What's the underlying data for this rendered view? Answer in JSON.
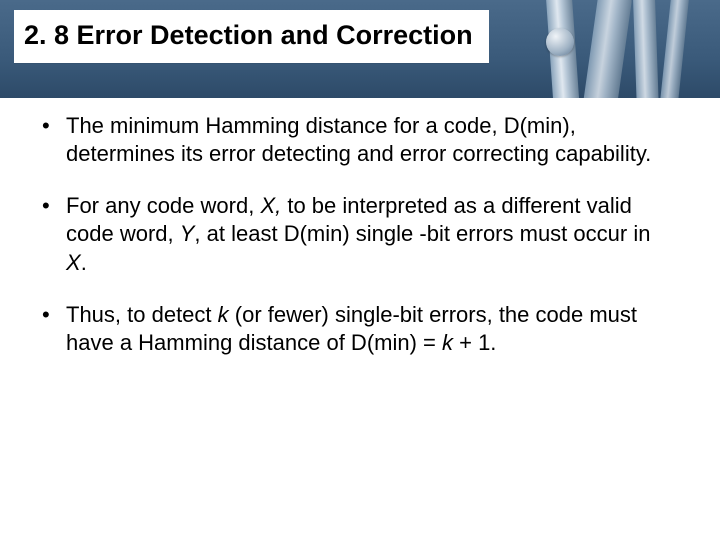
{
  "title": "2. 8 Error Detection and Correction",
  "bullets": [
    {
      "pre": "The minimum Hamming distance for a code, D(min), determines its error detecting and error correcting capability.",
      "seg": []
    },
    {
      "pre": "For any code word, ",
      "seg": [
        {
          "text": "X,",
          "italic": true
        },
        {
          "text": " to be interpreted as a different valid code word, ",
          "italic": false
        },
        {
          "text": "Y",
          "italic": true
        },
        {
          "text": ", at least D(min) single -bit errors must occur in ",
          "italic": false
        },
        {
          "text": "X",
          "italic": true
        },
        {
          "text": ".",
          "italic": false
        }
      ]
    },
    {
      "pre": "Thus, to detect ",
      "seg": [
        {
          "text": "k",
          "italic": true
        },
        {
          "text": " (or fewer) single-bit errors, the code must have a Hamming distance of D(min) = ",
          "italic": false
        },
        {
          "text": "k",
          "italic": true
        },
        {
          "text": " + 1.",
          "italic": false
        }
      ]
    }
  ]
}
